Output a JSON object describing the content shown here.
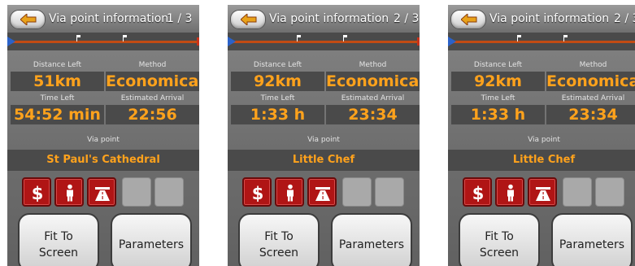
{
  "screens": [
    {
      "title": "Via point information",
      "page": "1 / 3",
      "labels": {
        "distance_left": "Distance Left",
        "method": "Method",
        "time_left": "Time Left",
        "estimated_arrival": "Estimated Arrival",
        "via_point": "Via point"
      },
      "values": {
        "distance_left": "51km",
        "method": "Economical",
        "time_left": "54:52 min",
        "estimated_arrival": "22:56"
      },
      "via_point_name": "St Paul's Cathedral",
      "buttons": {
        "fit_to_screen_line1": "Fit To",
        "fit_to_screen_line2": "Screen",
        "parameters": "Parameters"
      },
      "route_icons": [
        "dollar-icon",
        "pedestrian-icon",
        "highway-icon"
      ]
    },
    {
      "title": "Via point information",
      "page": "2 / 3",
      "labels": {
        "distance_left": "Distance Left",
        "method": "Method",
        "time_left": "Time Left",
        "estimated_arrival": "Estimated Arrival",
        "via_point": "Via point"
      },
      "values": {
        "distance_left": "92km",
        "method": "Economical",
        "time_left": "1:33 h",
        "estimated_arrival": "23:34"
      },
      "via_point_name": "Little Chef",
      "buttons": {
        "fit_to_screen_line1": "Fit To",
        "fit_to_screen_line2": "Screen",
        "parameters": "Parameters"
      },
      "route_icons": [
        "dollar-icon",
        "pedestrian-icon",
        "highway-icon"
      ]
    },
    {
      "title": "Via point information",
      "page": "2 / 3",
      "labels": {
        "distance_left": "Distance Left",
        "method": "Method",
        "time_left": "Time Left",
        "estimated_arrival": "Estimated Arrival",
        "via_point": "Via point"
      },
      "values": {
        "distance_left": "92km",
        "method": "Economical",
        "time_left": "1:33 h",
        "estimated_arrival": "23:34"
      },
      "via_point_name": "Little Chef",
      "buttons": {
        "fit_to_screen_line1": "Fit To",
        "fit_to_screen_line2": "Screen",
        "parameters": "Parameters"
      },
      "route_icons": [
        "dollar-icon",
        "pedestrian-icon",
        "highway-icon"
      ]
    }
  ],
  "colors": {
    "accent_orange": "#ffa21c",
    "route_red": "#c24b13",
    "icon_red": "#b01515",
    "start_blue": "#2b62c9"
  }
}
